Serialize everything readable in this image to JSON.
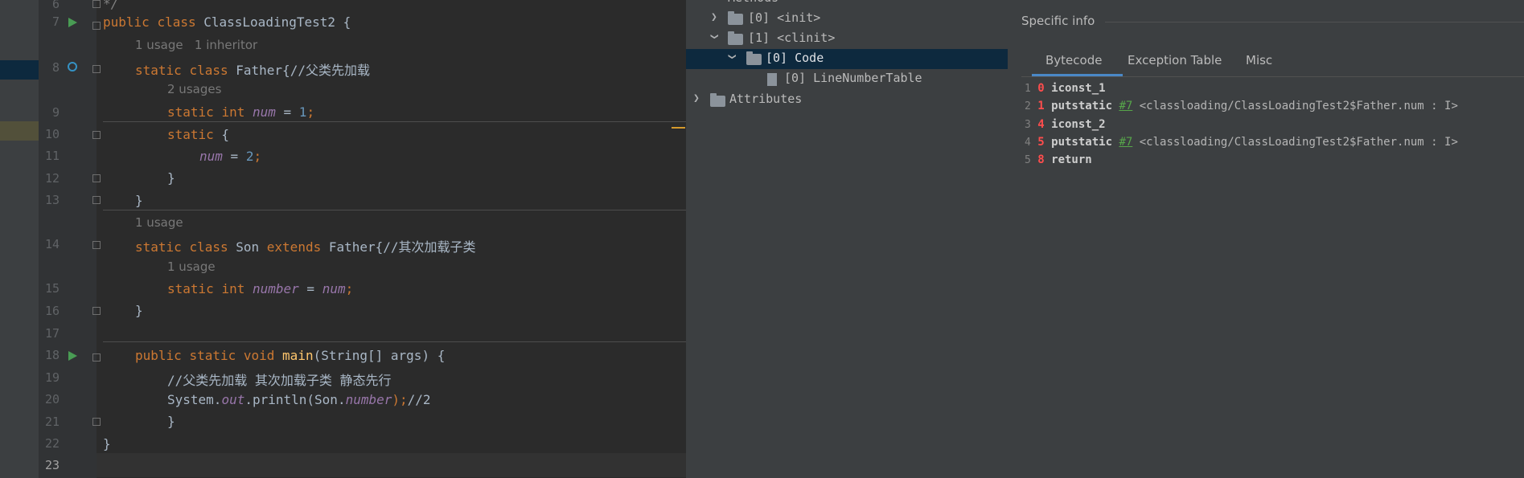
{
  "editor": {
    "lines": [
      {
        "num": "6",
        "html_tokens": []
      },
      {
        "num": "7"
      },
      {
        "num": "8"
      },
      {
        "num": "9"
      },
      {
        "num": "10"
      },
      {
        "num": "11"
      },
      {
        "num": "12"
      },
      {
        "num": "13"
      },
      {
        "num": "14"
      },
      {
        "num": "15"
      },
      {
        "num": "16"
      },
      {
        "num": "17"
      },
      {
        "num": "18"
      },
      {
        "num": "19"
      },
      {
        "num": "20"
      },
      {
        "num": "21"
      },
      {
        "num": "22"
      },
      {
        "num": "23"
      }
    ],
    "line6_code": "*/",
    "line7": {
      "kw1": "public",
      "kw2": "class",
      "name": "ClassLoadingTest2",
      "brace": " {"
    },
    "hint7a": "1 usage",
    "hint7b": "1 inheritor",
    "line8": {
      "kw1": "static",
      "kw2": "class",
      "name": "Father{",
      "comment": "//父类先加载"
    },
    "hint8": "2 usages",
    "line9": {
      "kw1": "static",
      "kw2": "int",
      "field": "num",
      "eq": " = ",
      "val": "1",
      "end": ";"
    },
    "line10": {
      "kw1": "static",
      "rest": " {"
    },
    "line11": {
      "field": "num",
      "eq": " = ",
      "val": "2",
      "end": ";"
    },
    "line12": "}",
    "line13": "}",
    "hint13": "1 usage",
    "line14": {
      "kw1": "static",
      "kw2": "class",
      "name": "Son ",
      "kw3": "extends",
      "name2": " Father{",
      "comment": "//其次加载子类"
    },
    "hint14": "1 usage",
    "line15": {
      "kw1": "static",
      "kw2": "int",
      "field": "number",
      "eq": " = ",
      "field2": "num",
      "end": ";"
    },
    "line16": "}",
    "line18": {
      "kw1": "public",
      "kw2": "static",
      "kw3": "void",
      "fn": "main",
      "rest": "(String[] args) {"
    },
    "line19": "//父类先加载 其次加载子类 静态先行",
    "line20": {
      "a": "System.",
      "b": "out",
      "c": ".println(Son.",
      "d": "number",
      "e": ");",
      "f": "//2"
    },
    "line21": "}",
    "line22": "}"
  },
  "tree": {
    "methods_label": "Methods",
    "items": [
      {
        "label": "[0] <init>"
      },
      {
        "label": "[1] <clinit>"
      },
      {
        "label": "[0] Code"
      },
      {
        "label": "[0] LineNumberTable"
      },
      {
        "label": "Attributes"
      }
    ]
  },
  "right": {
    "title": "Specific info",
    "tabs": [
      "Bytecode",
      "Exception Table",
      "Misc"
    ],
    "bytecode": [
      {
        "ln": "1",
        "off": "0",
        "op": "iconst_1",
        "ref": "",
        "arg": ""
      },
      {
        "ln": "2",
        "off": "1",
        "op": "putstatic",
        "ref": "#7",
        "arg": " <classloading/ClassLoadingTest2$Father.num : I>"
      },
      {
        "ln": "3",
        "off": "4",
        "op": "iconst_2",
        "ref": "",
        "arg": ""
      },
      {
        "ln": "4",
        "off": "5",
        "op": "putstatic",
        "ref": "#7",
        "arg": " <classloading/ClassLoadingTest2$Father.num : I>"
      },
      {
        "ln": "5",
        "off": "8",
        "op": "return",
        "ref": "",
        "arg": ""
      }
    ]
  },
  "colors": {
    "keyword": "#cc7832",
    "field": "#9876aa",
    "number": "#6897bb",
    "method": "#ffc66d",
    "selection": "#0d293e"
  }
}
